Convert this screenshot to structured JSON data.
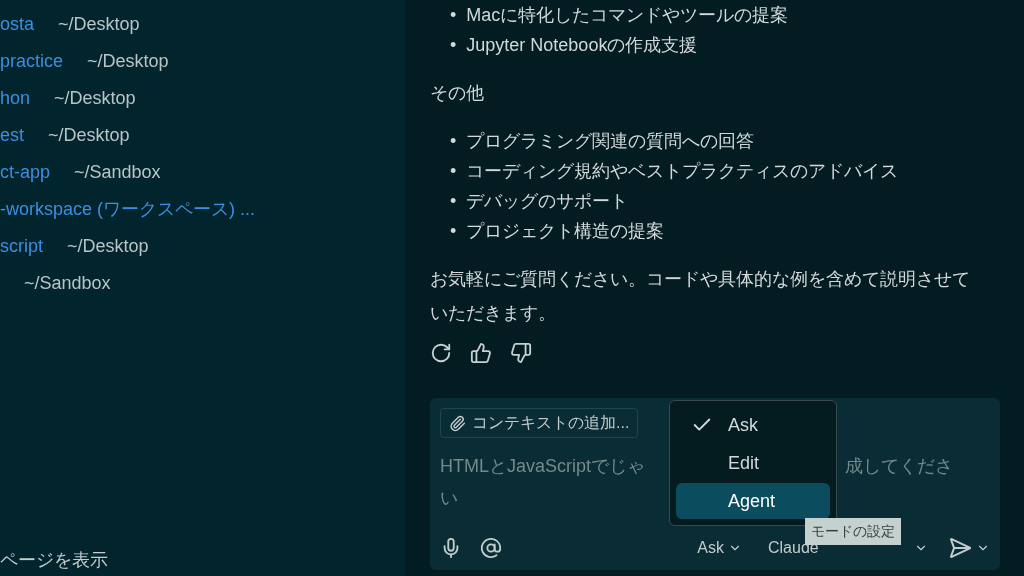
{
  "recent_projects": [
    {
      "name": "osta",
      "path": "~/Desktop"
    },
    {
      "name": "practice",
      "path": "~/Desktop"
    },
    {
      "name": "hon",
      "path": "~/Desktop"
    },
    {
      "name": "est",
      "path": "~/Desktop"
    },
    {
      "name": "ct-app",
      "path": "~/Sandbox"
    },
    {
      "name": "-workspace (ワークスペース) ..."
    },
    {
      "name": "script",
      "path": "~/Desktop"
    },
    {
      "path": "~/Sandbox"
    }
  ],
  "sidebar_footer": "ページを表示",
  "chat": {
    "blocks": [
      {
        "kind": "list",
        "marker": "•",
        "items": [
          "Macに特化したコマンドやツールの提案",
          "Jupyter Notebookの作成支援"
        ]
      },
      {
        "kind": "paragraph",
        "text": "その他"
      },
      {
        "kind": "list",
        "marker": "•",
        "items": [
          "プログラミング関連の質問への回答",
          "コーディング規約やベストプラクティスのアドバイス",
          "デバッグのサポート",
          "プロジェクト構造の提案"
        ]
      },
      {
        "kind": "paragraph",
        "text": "お気軽にご質問ください。コードや具体的な例を含めて説明させていただきます。"
      }
    ]
  },
  "composer": {
    "context_button": "コンテキストの追加...",
    "placeholder_parts": [
      "HTMLとJavaScriptでじゃ",
      "成してくださ",
      "い"
    ],
    "mode": "Ask",
    "model": "Claude"
  },
  "mode_menu": {
    "items": [
      {
        "label": "Ask",
        "checked": true,
        "selected": false
      },
      {
        "label": "Edit",
        "checked": false,
        "selected": false
      },
      {
        "label": "Agent",
        "checked": false,
        "selected": true
      }
    ]
  },
  "tooltip": "モードの設定"
}
